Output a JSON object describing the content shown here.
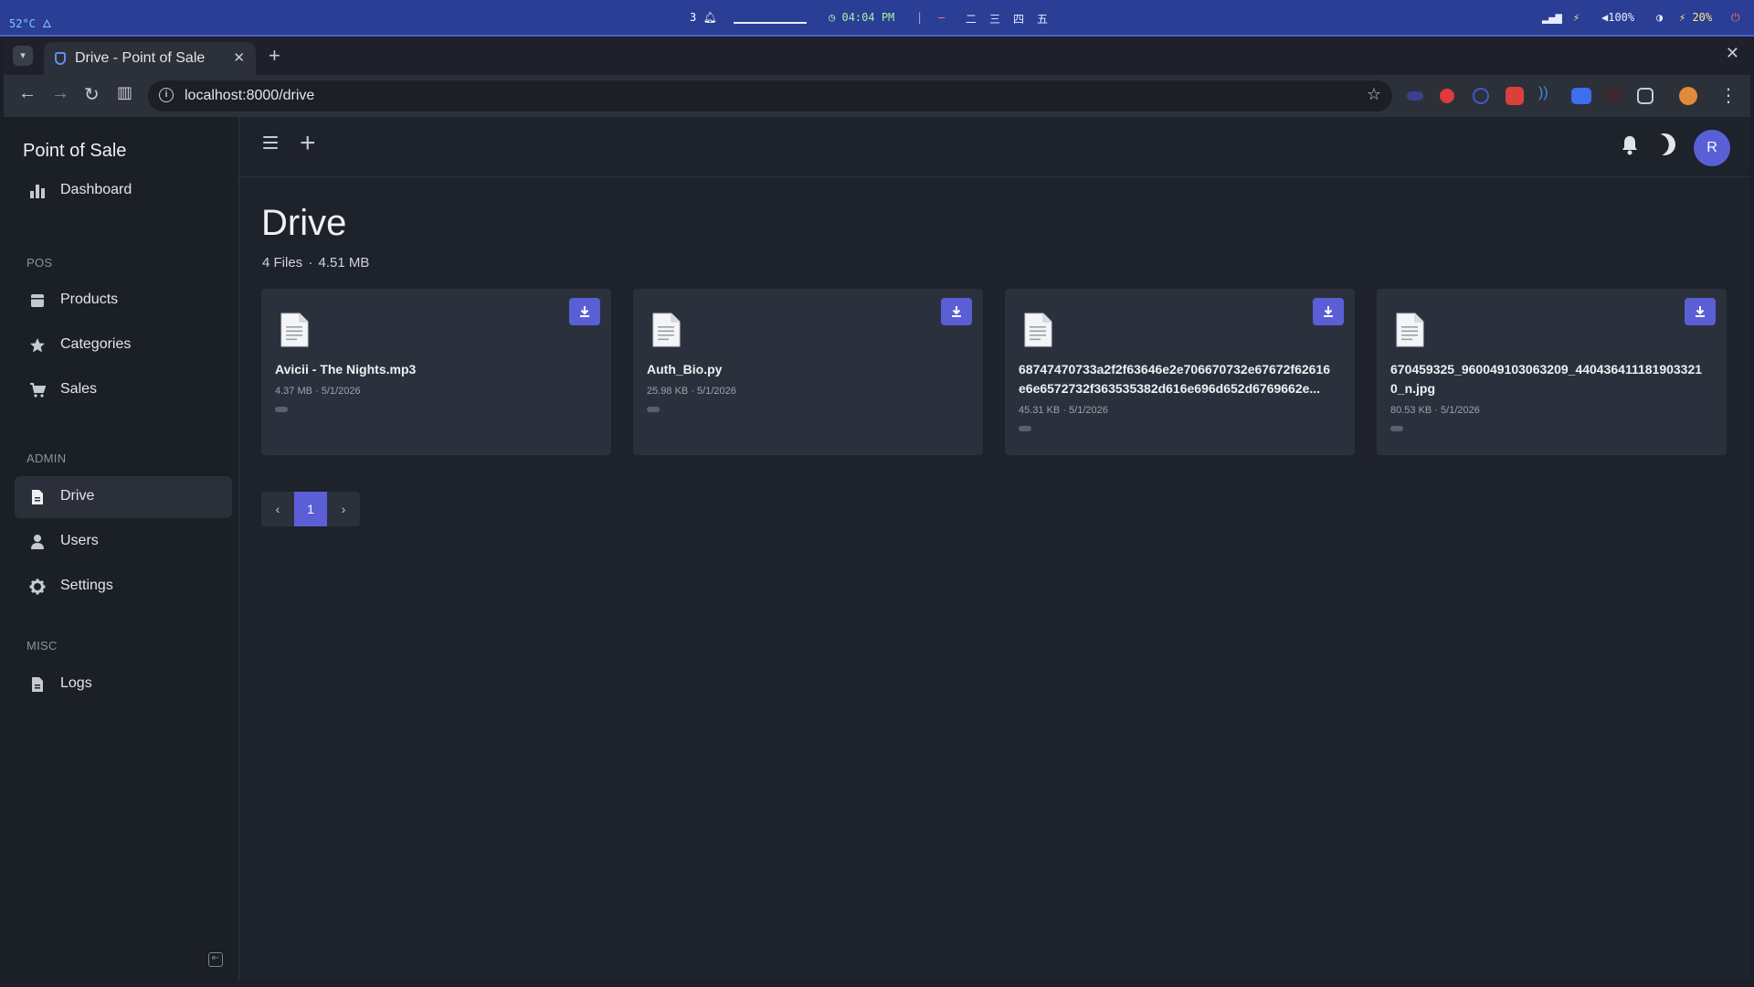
{
  "os": {
    "temp": "52°C",
    "temp_icon": "flame-icon",
    "notifications": "3",
    "clock": "04:04 PM",
    "volume": "100%",
    "battery": "20%",
    "accent": "#2a3e96"
  },
  "browser": {
    "tab_title": "Drive - Point of Sale",
    "url": "localhost:8000/drive"
  },
  "app": {
    "brand": "Point of Sale",
    "accent": "#5b5fd6",
    "avatar_initial": "R"
  },
  "sidebar": {
    "dashboard": "Dashboard",
    "section_pos": "POS",
    "products": "Products",
    "categories": "Categories",
    "sales": "Sales",
    "section_admin": "ADMIN",
    "drive": "Drive",
    "users": "Users",
    "settings": "Settings",
    "section_misc": "MISC",
    "logs": "Logs"
  },
  "page": {
    "title": "Drive",
    "files_count": "4 Files",
    "total_size": "4.51 MB"
  },
  "files": [
    {
      "name": "Avicii - The Nights.mp3",
      "size": "4.37 MB",
      "date": "5/1/2026"
    },
    {
      "name": "Auth_Bio.py",
      "size": "25.98 KB",
      "date": "5/1/2026"
    },
    {
      "name": "68747470733a2f2f63646e2e706670732e67672f62616e6e6572732f363535382d616e696d652d6769662e...",
      "size": "45.31 KB",
      "date": "5/1/2026"
    },
    {
      "name": "670459325_960049103063209_4404364111819033210_n.jpg",
      "size": "80.53 KB",
      "date": "5/1/2026"
    }
  ],
  "pagination": {
    "current": "1",
    "prev": "‹",
    "next": "›"
  }
}
